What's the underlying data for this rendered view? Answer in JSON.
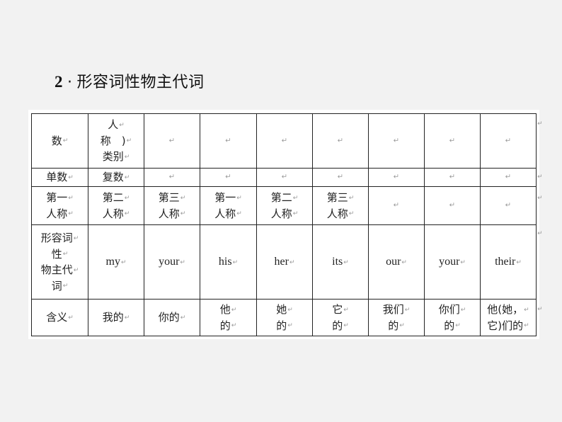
{
  "title": {
    "number": "2",
    "separator": "·",
    "text": "形容词性物主代词"
  },
  "paragraph_mark": "↵",
  "table": {
    "rows": [
      {
        "cells": [
          {
            "lines": [
              "数"
            ]
          },
          {
            "lines": [
              "人",
              "称　)",
              "类别"
            ]
          },
          {
            "lines": []
          },
          {
            "lines": []
          },
          {
            "lines": []
          },
          {
            "lines": []
          },
          {
            "lines": []
          },
          {
            "lines": []
          },
          {
            "lines": []
          }
        ]
      },
      {
        "cells": [
          {
            "lines": [
              "单数"
            ]
          },
          {
            "lines": [
              "复数"
            ]
          },
          {
            "lines": []
          },
          {
            "lines": []
          },
          {
            "lines": []
          },
          {
            "lines": []
          },
          {
            "lines": []
          },
          {
            "lines": []
          },
          {
            "lines": []
          }
        ]
      },
      {
        "cells": [
          {
            "lines": [
              "第一",
              "人称"
            ]
          },
          {
            "lines": [
              "第二",
              "人称"
            ]
          },
          {
            "lines": [
              "第三",
              "人称"
            ]
          },
          {
            "lines": [
              "第一",
              "人称"
            ]
          },
          {
            "lines": [
              "第二",
              "人称"
            ]
          },
          {
            "lines": [
              "第三",
              "人称"
            ]
          },
          {
            "lines": []
          },
          {
            "lines": []
          },
          {
            "lines": []
          }
        ]
      },
      {
        "cells": [
          {
            "lines": [
              "形容词",
              "性",
              "物主代",
              "词"
            ]
          },
          {
            "lines": [
              "my"
            ]
          },
          {
            "lines": [
              "your"
            ]
          },
          {
            "lines": [
              "his"
            ]
          },
          {
            "lines": [
              "her"
            ]
          },
          {
            "lines": [
              "its"
            ]
          },
          {
            "lines": [
              "our"
            ]
          },
          {
            "lines": [
              "your"
            ]
          },
          {
            "lines": [
              "their"
            ]
          }
        ]
      },
      {
        "cells": [
          {
            "lines": [
              "含义"
            ]
          },
          {
            "lines": [
              "我的"
            ]
          },
          {
            "lines": [
              "你的"
            ]
          },
          {
            "lines": [
              "他",
              "的"
            ]
          },
          {
            "lines": [
              "她",
              "的"
            ]
          },
          {
            "lines": [
              "它",
              "的"
            ]
          },
          {
            "lines": [
              "我们",
              "的"
            ]
          },
          {
            "lines": [
              "你们",
              "的"
            ]
          },
          {
            "lines": [
              "他(她，",
              "它)们的"
            ]
          }
        ]
      }
    ]
  }
}
